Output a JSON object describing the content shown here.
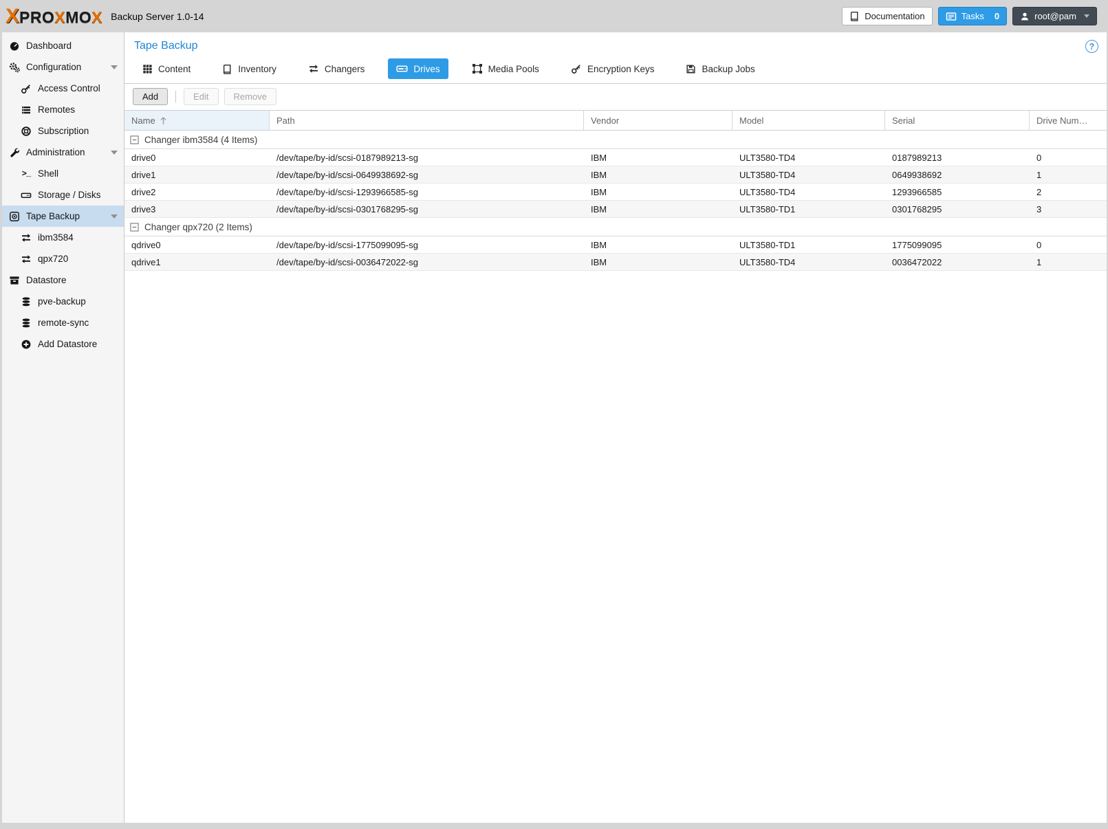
{
  "header": {
    "logo": {
      "mark": "X",
      "p1": "PRO",
      "x1": "X",
      "p2": "MO",
      "x2": "X"
    },
    "app_title": "Backup Server 1.0-14",
    "documentation_label": "Documentation",
    "tasks_label": "Tasks",
    "tasks_count": "0",
    "user_label": "root@pam"
  },
  "icons": {
    "help_glyph": "?",
    "shell_glyph": ">_"
  },
  "sidebar": {
    "items": [
      {
        "label": "Dashboard",
        "icon": "dashboard"
      },
      {
        "label": "Configuration",
        "icon": "gears",
        "expandable": true
      },
      {
        "label": "Access Control",
        "icon": "key"
      },
      {
        "label": "Remotes",
        "icon": "list-bars"
      },
      {
        "label": "Subscription",
        "icon": "life-ring"
      },
      {
        "label": "Administration",
        "icon": "wrench",
        "expandable": true
      },
      {
        "label": "Shell",
        "icon": "terminal"
      },
      {
        "label": "Storage / Disks",
        "icon": "hdd"
      },
      {
        "label": "Tape Backup",
        "icon": "tape-record",
        "expandable": true,
        "selected": true
      },
      {
        "label": "ibm3584",
        "icon": "exchange-arrows"
      },
      {
        "label": "qpx720",
        "icon": "exchange-arrows"
      },
      {
        "label": "Datastore",
        "icon": "archive-box"
      },
      {
        "label": "pve-backup",
        "icon": "database"
      },
      {
        "label": "remote-sync",
        "icon": "database"
      },
      {
        "label": "Add Datastore",
        "icon": "plus-circle"
      }
    ]
  },
  "main": {
    "title": "Tape Backup",
    "tabs": [
      {
        "label": "Content",
        "icon": "grid"
      },
      {
        "label": "Inventory",
        "icon": "book"
      },
      {
        "label": "Changers",
        "icon": "exchange-arrows"
      },
      {
        "label": "Drives",
        "icon": "tape-drive",
        "active": true
      },
      {
        "label": "Media Pools",
        "icon": "object-group"
      },
      {
        "label": "Encryption Keys",
        "icon": "key"
      },
      {
        "label": "Backup Jobs",
        "icon": "save"
      }
    ],
    "toolbar": {
      "add": "Add",
      "edit": "Edit",
      "remove": "Remove"
    },
    "table": {
      "columns": [
        "Name",
        "Path",
        "Vendor",
        "Model",
        "Serial",
        "Drive Num…"
      ],
      "sorted_column": "Name",
      "sort_direction": "ascending",
      "groups": [
        {
          "label": "Changer ibm3584 (4 Items)",
          "rows": [
            {
              "name": "drive0",
              "path": "/dev/tape/by-id/scsi-0187989213-sg",
              "vendor": "IBM",
              "model": "ULT3580-TD4",
              "serial": "0187989213",
              "drive_number": "0"
            },
            {
              "name": "drive1",
              "path": "/dev/tape/by-id/scsi-0649938692-sg",
              "vendor": "IBM",
              "model": "ULT3580-TD4",
              "serial": "0649938692",
              "drive_number": "1"
            },
            {
              "name": "drive2",
              "path": "/dev/tape/by-id/scsi-1293966585-sg",
              "vendor": "IBM",
              "model": "ULT3580-TD4",
              "serial": "1293966585",
              "drive_number": "2"
            },
            {
              "name": "drive3",
              "path": "/dev/tape/by-id/scsi-0301768295-sg",
              "vendor": "IBM",
              "model": "ULT3580-TD1",
              "serial": "0301768295",
              "drive_number": "3"
            }
          ]
        },
        {
          "label": "Changer qpx720 (2 Items)",
          "rows": [
            {
              "name": "qdrive0",
              "path": "/dev/tape/by-id/scsi-1775099095-sg",
              "vendor": "IBM",
              "model": "ULT3580-TD1",
              "serial": "1775099095",
              "drive_number": "0"
            },
            {
              "name": "qdrive1",
              "path": "/dev/tape/by-id/scsi-0036472022-sg",
              "vendor": "IBM",
              "model": "ULT3580-TD4",
              "serial": "0036472022",
              "drive_number": "1"
            }
          ]
        }
      ]
    }
  },
  "colors": {
    "accent_blue": "#2e9be6",
    "title_blue": "#1f86d4",
    "brand_orange": "#e57000",
    "selection_blue": "#c8dcef",
    "chrome_gray": "#d5d5d5",
    "sidebar_gray": "#f5f5f5"
  }
}
